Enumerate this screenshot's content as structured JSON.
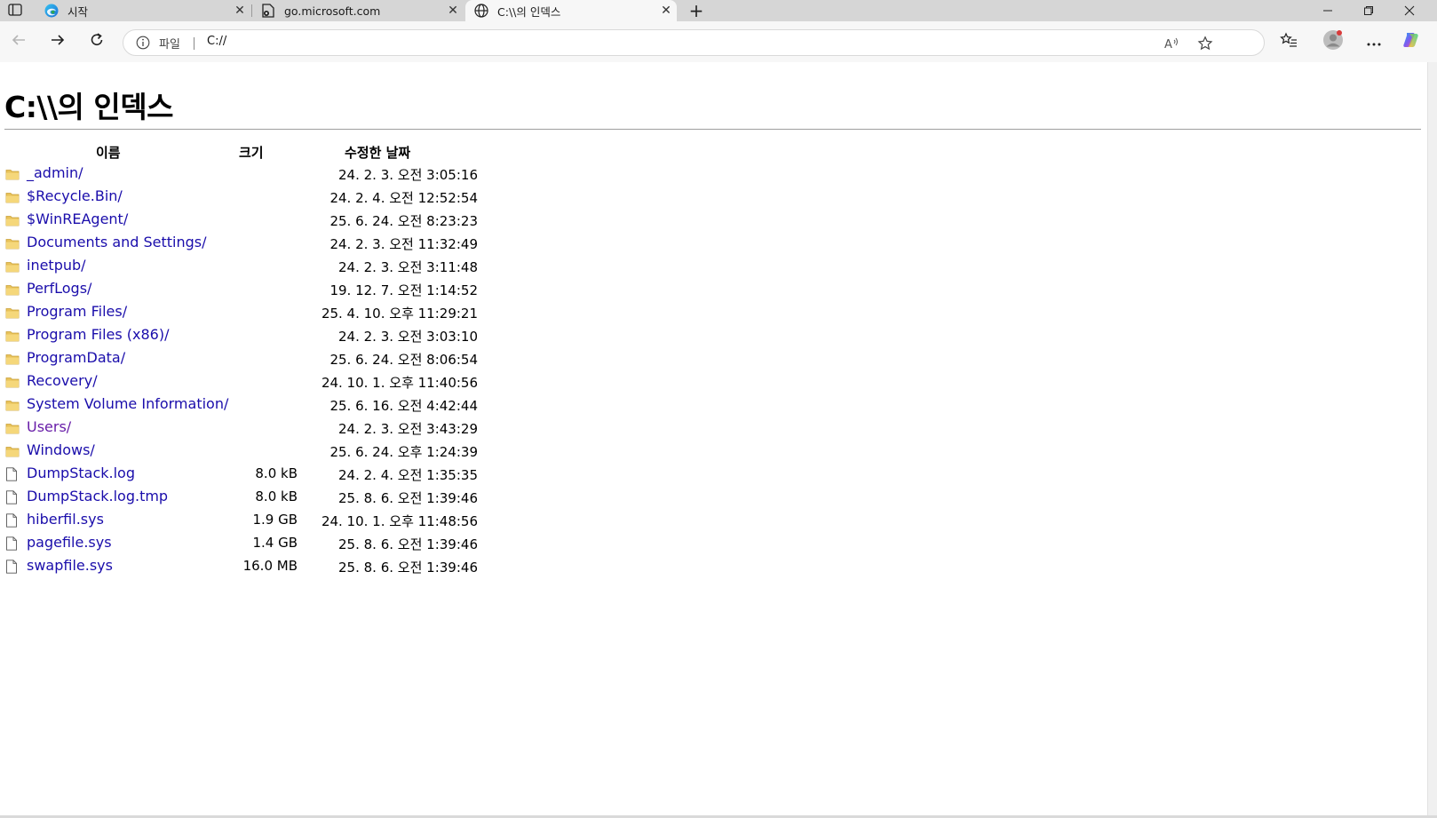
{
  "browser": {
    "tabs": [
      {
        "title": "시작",
        "icon": "edge-logo-icon",
        "active": false
      },
      {
        "title": "go.microsoft.com",
        "icon": "page-icon",
        "active": false
      },
      {
        "title": "C:\\\\의 인덱스",
        "icon": "globe-icon",
        "active": true
      }
    ],
    "window_buttons": [
      "minimize",
      "restore",
      "close"
    ],
    "address": {
      "scheme_label": "파일",
      "url": "C://"
    }
  },
  "page": {
    "title": "C:\\\\의 인덱스",
    "columns": {
      "name": "이름",
      "size": "크기",
      "modified": "수정한 날짜"
    },
    "entries": [
      {
        "name": "_admin/",
        "type": "folder",
        "size": "",
        "modified": "24. 2. 3. 오전 3:05:16"
      },
      {
        "name": "$Recycle.Bin/",
        "type": "folder",
        "size": "",
        "modified": "24. 2. 4. 오전 12:52:54"
      },
      {
        "name": "$WinREAgent/",
        "type": "folder",
        "size": "",
        "modified": "25. 6. 24. 오전 8:23:23"
      },
      {
        "name": "Documents and Settings/",
        "type": "folder",
        "size": "",
        "modified": "24. 2. 3. 오전 11:32:49"
      },
      {
        "name": "inetpub/",
        "type": "folder",
        "size": "",
        "modified": "24. 2. 3. 오전 3:11:48"
      },
      {
        "name": "PerfLogs/",
        "type": "folder",
        "size": "",
        "modified": "19. 12. 7. 오전 1:14:52"
      },
      {
        "name": "Program Files/",
        "type": "folder",
        "size": "",
        "modified": "25. 4. 10. 오후 11:29:21"
      },
      {
        "name": "Program Files (x86)/",
        "type": "folder",
        "size": "",
        "modified": "24. 2. 3. 오전 3:03:10"
      },
      {
        "name": "ProgramData/",
        "type": "folder",
        "size": "",
        "modified": "25. 6. 24. 오전 8:06:54"
      },
      {
        "name": "Recovery/",
        "type": "folder",
        "size": "",
        "modified": "24. 10. 1. 오후 11:40:56"
      },
      {
        "name": "System Volume Information/",
        "type": "folder",
        "size": "",
        "modified": "25. 6. 16. 오전 4:42:44"
      },
      {
        "name": "Users/",
        "type": "folder",
        "size": "",
        "modified": "24. 2. 3. 오전 3:43:29",
        "visited": true
      },
      {
        "name": "Windows/",
        "type": "folder",
        "size": "",
        "modified": "25. 6. 24. 오후 1:24:39"
      },
      {
        "name": "DumpStack.log",
        "type": "file",
        "size": "8.0 kB",
        "modified": "24. 2. 4. 오전 1:35:35"
      },
      {
        "name": "DumpStack.log.tmp",
        "type": "file",
        "size": "8.0 kB",
        "modified": "25. 8. 6. 오전 1:39:46"
      },
      {
        "name": "hiberfil.sys",
        "type": "file",
        "size": "1.9 GB",
        "modified": "24. 10. 1. 오후 11:48:56"
      },
      {
        "name": "pagefile.sys",
        "type": "file",
        "size": "1.4 GB",
        "modified": "25. 8. 6. 오전 1:39:46"
      },
      {
        "name": "swapfile.sys",
        "type": "file",
        "size": "16.0 MB",
        "modified": "25. 8. 6. 오전 1:39:46"
      }
    ]
  },
  "colors": {
    "link": "#1a0dab",
    "visited_link": "#681da8",
    "tabstrip_bg": "#d6d6d6",
    "toolbar_bg": "#f7f7f7"
  }
}
